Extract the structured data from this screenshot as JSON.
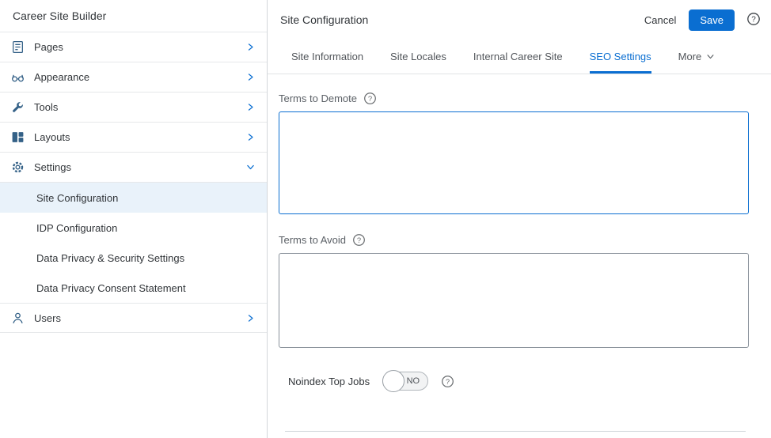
{
  "sidebar": {
    "title": "Career Site Builder",
    "items": [
      {
        "label": "Pages"
      },
      {
        "label": "Appearance"
      },
      {
        "label": "Tools"
      },
      {
        "label": "Layouts"
      },
      {
        "label": "Settings"
      },
      {
        "label": "Users"
      }
    ],
    "settings_children": [
      {
        "label": "Site Configuration",
        "selected": true
      },
      {
        "label": "IDP Configuration"
      },
      {
        "label": "Data Privacy & Security Settings"
      },
      {
        "label": "Data Privacy Consent Statement"
      }
    ]
  },
  "header": {
    "title": "Site Configuration",
    "cancel_label": "Cancel",
    "save_label": "Save"
  },
  "tabs": [
    {
      "label": "Site Information",
      "active": false
    },
    {
      "label": "Site Locales",
      "active": false
    },
    {
      "label": "Internal Career Site",
      "active": false
    },
    {
      "label": "SEO Settings",
      "active": true
    },
    {
      "label": "More",
      "active": false,
      "has_dropdown": true
    }
  ],
  "content": {
    "terms_to_demote_label": "Terms to Demote",
    "terms_to_demote_value": "",
    "terms_to_avoid_label": "Terms to Avoid",
    "terms_to_avoid_value": "",
    "noindex_label": "Noindex Top Jobs",
    "noindex_state": "NO"
  },
  "icons": {
    "help_glyph": "?"
  },
  "colors": {
    "accent": "#0a6ed1",
    "icon": "#346187",
    "border": "#d3d7da"
  }
}
